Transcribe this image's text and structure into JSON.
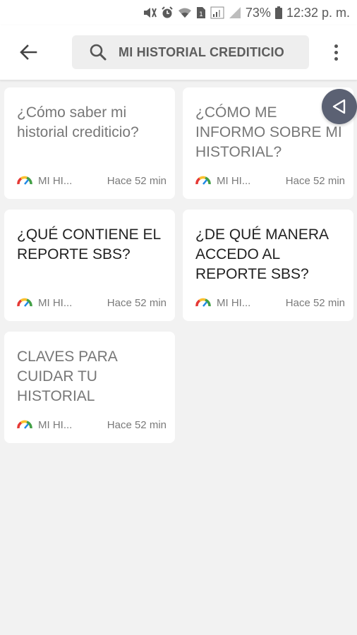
{
  "status_bar": {
    "battery": "73%",
    "time": "12:32 p. m."
  },
  "app_bar": {
    "search_query": "MI HISTORIAL CREDITICIO",
    "icons": [
      "back-arrow-icon",
      "search-icon",
      "more-vert-icon"
    ]
  },
  "cards": [
    {
      "title": "¿Cómo saber mi historial crediticio?",
      "source": "MI HI...",
      "time": "Hace 52 min",
      "read": true
    },
    {
      "title": "¿CÓMO ME INFORMO SOBRE MI HISTORIAL?",
      "source": "MI HI...",
      "time": "Hace 52 min",
      "read": true
    },
    {
      "title": "¿QUÉ CONTIENE EL REPORTE SBS?",
      "source": "MI HI...",
      "time": "Hace 52 min",
      "read": false
    },
    {
      "title": "¿DE QUÉ MANERA ACCEDO AL REPORTE SBS?",
      "source": "MI HI...",
      "time": "Hace 52 min",
      "read": false
    },
    {
      "title": "CLAVES PARA CUIDAR TU HISTORIAL",
      "source": "MI HI...",
      "time": "Hace 52 min",
      "read": true
    }
  ],
  "colors": {
    "background": "#f2f2f2",
    "card": "#ffffff",
    "read_title": "#777777",
    "unread_title": "#222222",
    "bubble": "#5b6173"
  }
}
